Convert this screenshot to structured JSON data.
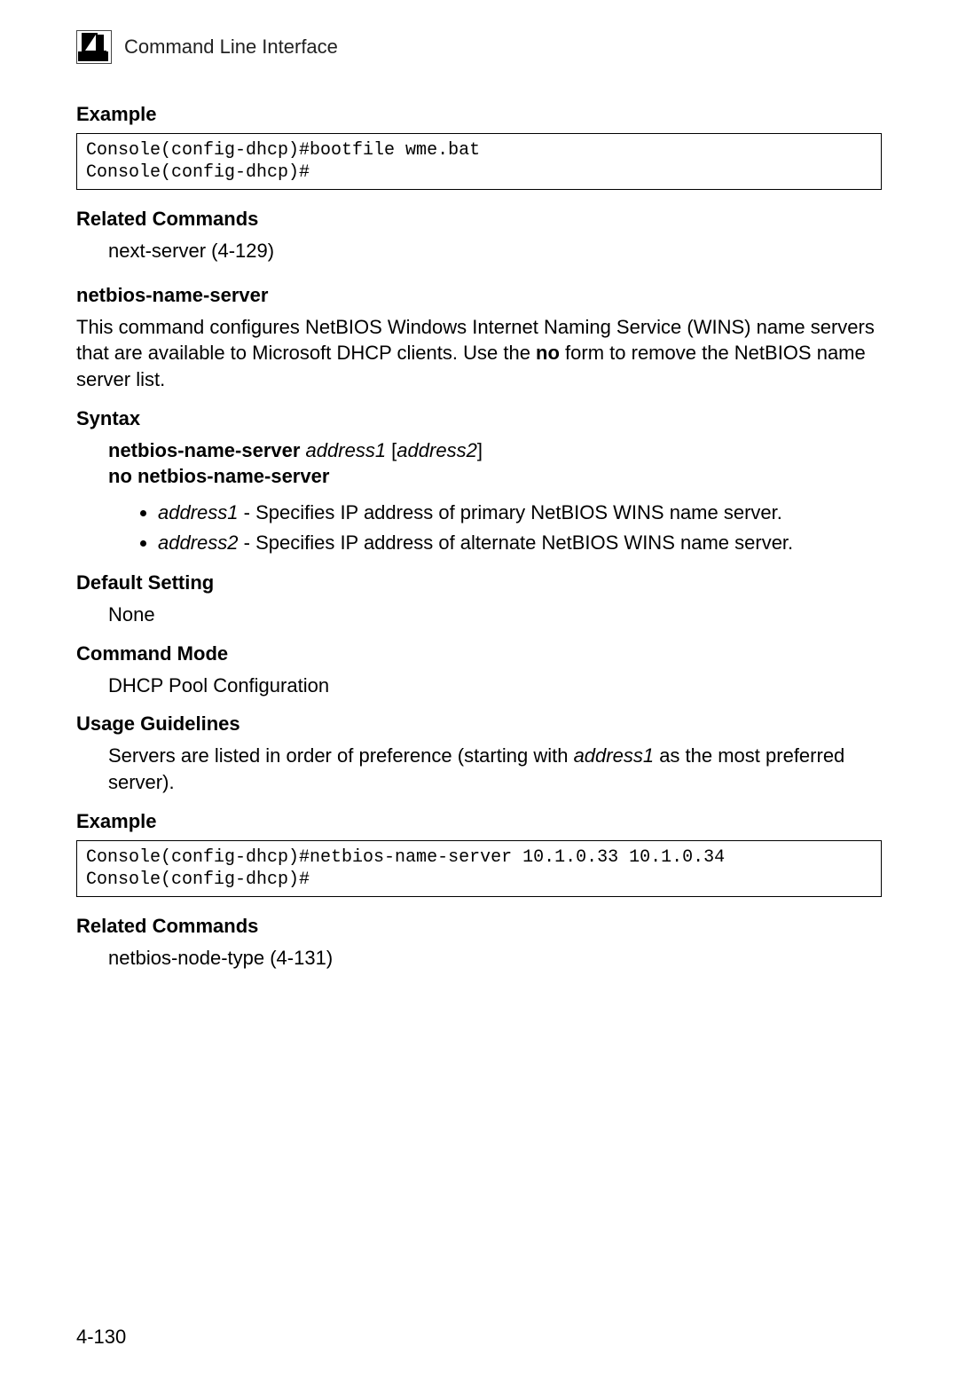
{
  "header": {
    "chapter_number": "4",
    "title": "Command Line Interface"
  },
  "sections": {
    "example1_heading": "Example",
    "example1_code": "Console(config-dhcp)#bootfile wme.bat\nConsole(config-dhcp)#",
    "related1_heading": "Related Commands",
    "related1_text": "next-server (4-129)",
    "cmd_heading": "netbios-name-server",
    "cmd_desc_pre": "This command configures NetBIOS Windows Internet Naming Service (WINS) name servers that are available to Microsoft DHCP clients. Use the ",
    "cmd_desc_bold": "no",
    "cmd_desc_post": " form to remove the NetBIOS name server list.",
    "syntax_heading": "Syntax",
    "syntax_line1_bold": "netbios-name-server",
    "syntax_line1_space": " ",
    "syntax_line1_it1": "address1",
    "syntax_line1_lbrack": " [",
    "syntax_line1_it2": "address2",
    "syntax_line1_rbrack": "]",
    "syntax_line2": "no netbios-name-server",
    "param1_it": "address1",
    "param1_text": " - Specifies IP address of primary NetBIOS WINS name server.",
    "param2_it": "address2",
    "param2_text": " - Specifies IP address of alternate NetBIOS WINS name server.",
    "default_heading": "Default Setting",
    "default_text": "None",
    "mode_heading": "Command Mode",
    "mode_text": "DHCP Pool Configuration",
    "usage_heading": "Usage Guidelines",
    "usage_pre": "Servers are listed in order of preference (starting with ",
    "usage_it": "address1",
    "usage_post": " as the most preferred server).",
    "example2_heading": "Example",
    "example2_code": "Console(config-dhcp)#netbios-name-server 10.1.0.33 10.1.0.34\nConsole(config-dhcp)#",
    "related2_heading": "Related Commands",
    "related2_text": "netbios-node-type (4-131)"
  },
  "page_number": "4-130"
}
